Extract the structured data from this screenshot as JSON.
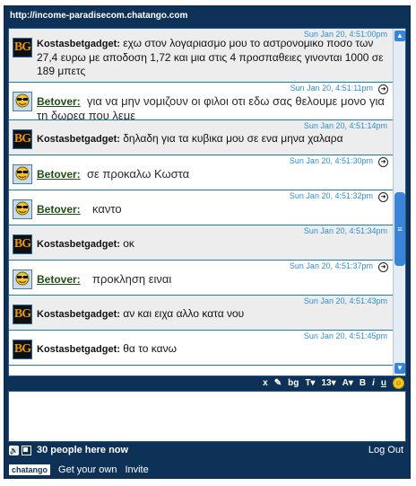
{
  "window": {
    "url": "http://income-paradisecom.chatango.com"
  },
  "messages": [
    {
      "user": "Kostasbetgadget:",
      "avatar": "BG",
      "time": "Sun Jan 20, 4:51:00pm",
      "text": "εχω στον λογαριασμο μου το αστρονομικο ποσο των 27,4 ευρω με αποδοση 1,72 και μια στις 4 προσπαθειες γινονται 1000 σε 189 μπετς"
    },
    {
      "user": "Betover:",
      "avatar": "betover-avatar",
      "time": "Sun Jan 20, 4:51:11pm",
      "text": "για να μην νομιζουν οι φιλοι οτι εδω σας θελουμε μονο για τη δωρεα που λεμε"
    },
    {
      "user": "Kostasbetgadget:",
      "avatar": "BG",
      "time": "Sun Jan 20, 4:51:14pm",
      "text": "δηλαδη για τα κυβικα μου σε ενα μηνα χαλαρα"
    },
    {
      "user": "Betover:",
      "avatar": "betover-avatar",
      "time": "Sun Jan 20, 4:51:30pm",
      "text": "σε προκαλω Κωστα"
    },
    {
      "user": "Betover:",
      "avatar": "betover-avatar",
      "time": "Sun Jan 20, 4:51:32pm",
      "text": "καντο"
    },
    {
      "user": "Kostasbetgadget:",
      "avatar": "BG",
      "time": "Sun Jan 20, 4:51:34pm",
      "text": "οκ"
    },
    {
      "user": "Betover:",
      "avatar": "betover-avatar",
      "time": "Sun Jan 20, 4:51:37pm",
      "text": "προκληση ειναι"
    },
    {
      "user": "Kostasbetgadget:",
      "avatar": "BG",
      "time": "Sun Jan 20, 4:51:43pm",
      "text": "αν και ειχα αλλο κατα νου"
    },
    {
      "user": "Kostasbetgadget:",
      "avatar": "BG",
      "time": "Sun Jan 20, 4:51:45pm",
      "text": "θα το κανω"
    }
  ],
  "reply_icon": "reply-arrow-icon",
  "scrollbar_grip": "≡",
  "toolbar": {
    "clear": "x",
    "pen_icon": "pen-icon",
    "bg": "bg",
    "text_style": "T▾",
    "font_size": "13▾",
    "color": "A▾",
    "bold": "B",
    "italic": "i",
    "underline": "u",
    "smiley_icon": "smiley-icon"
  },
  "status": {
    "people_count": "30 people here now",
    "logout": "Log Out"
  },
  "footer": {
    "logo": "chatango",
    "get_your_own": "Get your own",
    "invite": "Invite"
  },
  "colors": {
    "frame": "#0e3257",
    "timestamp": "#2f8fd8",
    "row_alt": "#ededed",
    "scroll": "#3a84d9"
  }
}
